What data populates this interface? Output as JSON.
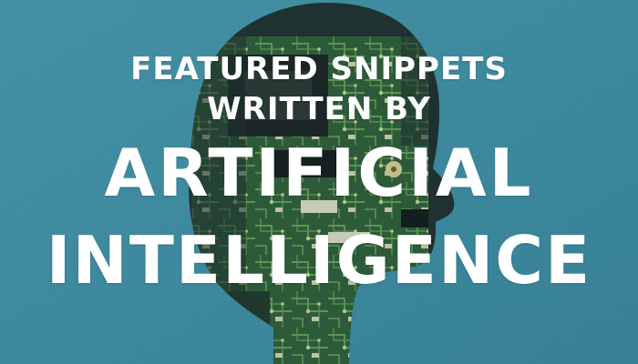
{
  "colors": {
    "background": "#4a9cb2",
    "silhouette_dark": "#1f2a26",
    "circuit_green": "#3f7a3c",
    "text": "#ffffff"
  },
  "artwork": {
    "silhouette": "human-head-profile",
    "pattern": "circuit-board"
  },
  "headline": {
    "line1": "FEATURED SNIPPETS",
    "line2": "WRITTEN BY",
    "line3": "ARTIFICIAL",
    "line4": "INTELLIGENCE"
  }
}
